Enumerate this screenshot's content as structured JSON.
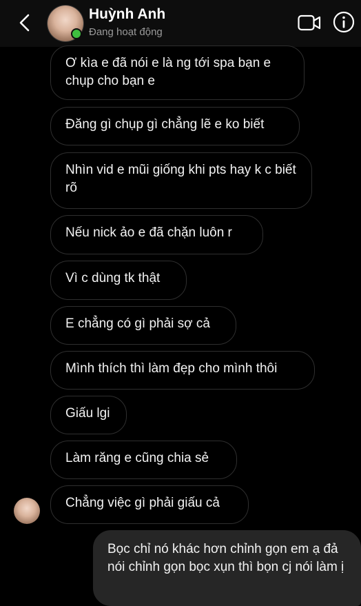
{
  "header": {
    "contact_name": "Huỳnh Anh",
    "status": "Đang hoạt động"
  },
  "messages": {
    "received": [
      "Ơ kìa e đã nói e là ng tới spa bạn e chụp cho bạn e",
      "Đăng gì chụp gì chẳng lẽ e ko biết",
      "Nhìn vid e mũi giống khi pts hay k c biết rõ",
      "Nếu nick ảo e đã chặn luôn r",
      "Vì c dùng tk thật",
      "E chẳng có gì phải sợ cả",
      "Mình thích thì làm đẹp cho mình thôi",
      "Giấu lgi",
      "Làm răng e cũng chia sẻ",
      "Chẳng việc gì phải giấu cả"
    ],
    "sent": [
      "Bọc chỉ nó khác hơn chỉnh gọn em ạ đả nói chỉnh gọn bọc xụn thì bọn cj nói làm ị"
    ]
  }
}
